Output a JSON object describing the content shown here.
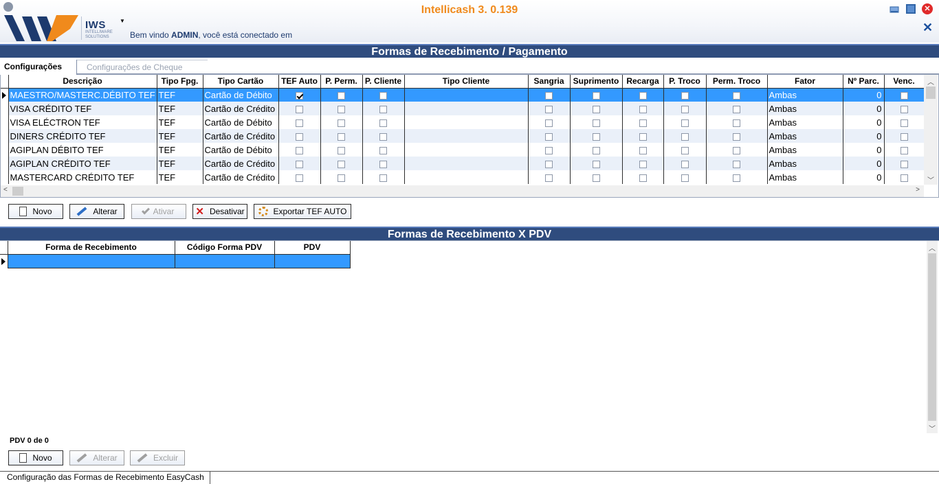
{
  "app": {
    "title": "Intellicash 3. 0.139",
    "brand": "IWS",
    "brand_sub": "INTELLIWARE SOLUTIONS",
    "welcome_prefix": "Bem vindo ",
    "welcome_user": "ADMIN",
    "welcome_suffix": ", você está conectado em"
  },
  "section1": {
    "title": "Formas de Recebimento / Pagamento"
  },
  "tabs": [
    {
      "label": "Configurações",
      "active": true
    },
    {
      "label": "Configurações de Cheque",
      "active": false
    }
  ],
  "grid1": {
    "columns": [
      "Descrição",
      "Tipo Fpg.",
      "Tipo Cartão",
      "TEF Auto",
      "P. Perm.",
      "P. Cliente",
      "Tipo Cliente",
      "Sangria",
      "Suprimento",
      "Recarga",
      "P. Troco",
      "Perm. Troco",
      "Fator",
      "Nº Parc.",
      "Venc."
    ],
    "rows": [
      {
        "descricao": "MAESTRO/MASTERC.DÉBITO TEF",
        "tipo_fpg": "TEF",
        "tipo_cartao": "Cartão de Débito",
        "tef_auto": true,
        "fator": "Ambas",
        "parc": "0"
      },
      {
        "descricao": "VISA CRÉDITO TEF",
        "tipo_fpg": "TEF",
        "tipo_cartao": "Cartão de Crédito",
        "tef_auto": false,
        "fator": "Ambas",
        "parc": "0"
      },
      {
        "descricao": "VISA ELÉCTRON TEF",
        "tipo_fpg": "TEF",
        "tipo_cartao": "Cartão de Débito",
        "tef_auto": false,
        "fator": "Ambas",
        "parc": "0"
      },
      {
        "descricao": "DINERS CRÉDITO TEF",
        "tipo_fpg": "TEF",
        "tipo_cartao": "Cartão de Crédito",
        "tef_auto": false,
        "fator": "Ambas",
        "parc": "0"
      },
      {
        "descricao": "AGIPLAN DÉBITO TEF",
        "tipo_fpg": "TEF",
        "tipo_cartao": "Cartão de Débito",
        "tef_auto": false,
        "fator": "Ambas",
        "parc": "0"
      },
      {
        "descricao": "AGIPLAN CRÉDITO TEF",
        "tipo_fpg": "TEF",
        "tipo_cartao": "Cartão de Crédito",
        "tef_auto": false,
        "fator": "Ambas",
        "parc": "0"
      },
      {
        "descricao": "MASTERCARD CRÉDITO TEF",
        "tipo_fpg": "TEF",
        "tipo_cartao": "Cartão de Crédito",
        "tef_auto": false,
        "fator": "Ambas",
        "parc": "0"
      }
    ]
  },
  "toolbar1": {
    "novo": "Novo",
    "alterar": "Alterar",
    "ativar": "Ativar",
    "desativar": "Desativar",
    "exportar": "Exportar TEF AUTO"
  },
  "section2": {
    "title": "Formas de Recebimento X PDV"
  },
  "grid2": {
    "columns": [
      "Forma de Recebimento",
      "Código Forma PDV",
      "PDV"
    ]
  },
  "pdv_count": "PDV 0 de 0",
  "toolbar2": {
    "novo": "Novo",
    "alterar": "Alterar",
    "excluir": "Excluir"
  },
  "status": {
    "text": "Configuração das Formas de Recebimento EasyCash"
  },
  "colors": {
    "accent": "#f08a1c",
    "bar": "#2f4c7e",
    "selection": "#3399ff"
  }
}
